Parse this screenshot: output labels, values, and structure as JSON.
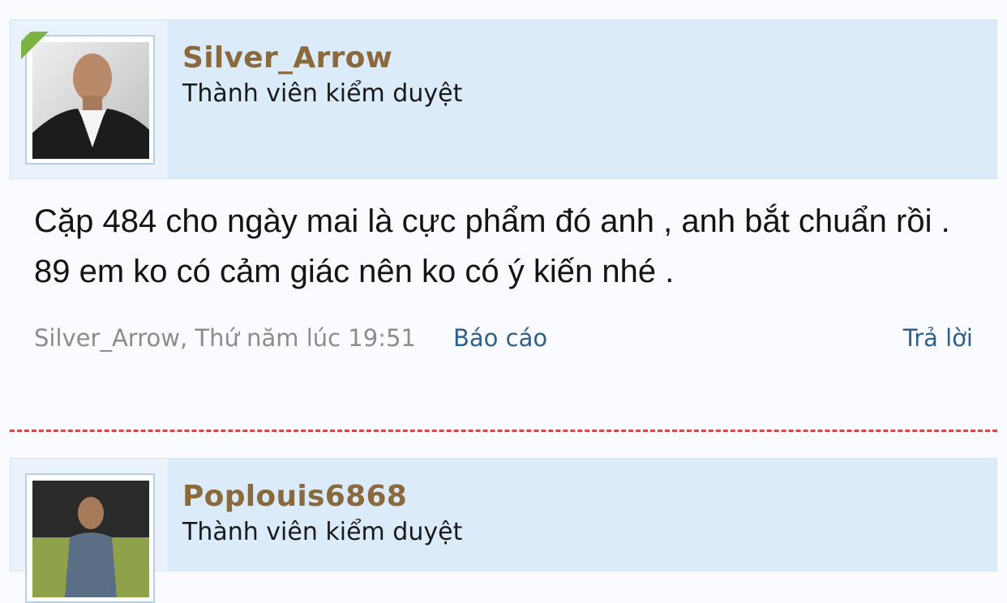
{
  "posts": [
    {
      "username": "Silver_Arrow",
      "user_title": "Thành viên kiểm duyệt",
      "message": "Cặp 484 cho ngày mai là cực phẩm đó anh , anh bắt chuẩn rồi . 89 em ko có cảm giác nên ko có ý kiến nhé .",
      "author_date": "Silver_Arrow, Thứ năm lúc 19:51",
      "report_label": "Báo cáo",
      "reply_label": "Trả lời",
      "online": true
    },
    {
      "username": "Poplouis6868",
      "user_title": "Thành viên kiểm duyệt"
    }
  ],
  "colors": {
    "username": "#8a6a3d",
    "link": "#2d5f8f",
    "header_bg": "#dbebf9",
    "divider": "#c94b4b",
    "online_badge": "#7cb342"
  }
}
